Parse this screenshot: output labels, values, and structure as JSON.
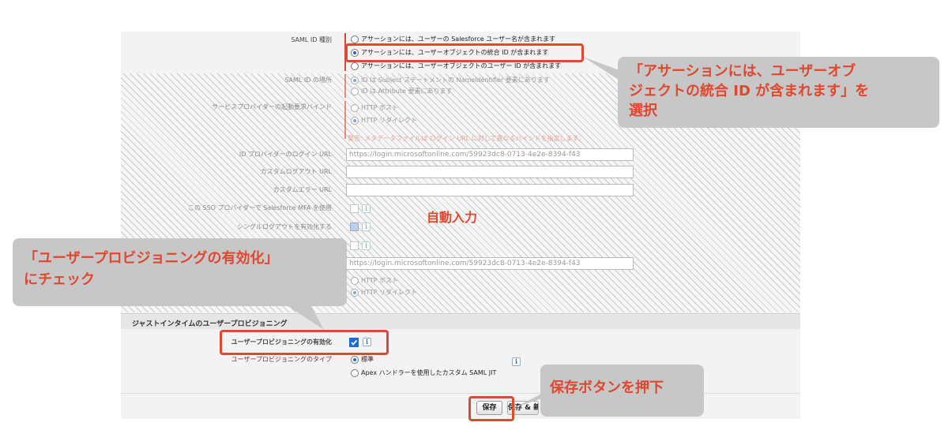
{
  "saml_id_type": {
    "label": "SAML ID 種別",
    "options": [
      "アサーションには、ユーザーの Salesforce ユーザー名が含まれます",
      "アサーションには、ユーザーオブジェクトの統合 ID が含まれます",
      "アサーションには、ユーザーオブジェクトのユーザー ID が含まれます"
    ],
    "selected_index": 1
  },
  "saml_id_location": {
    "label": "SAML ID の場所",
    "options": [
      "ID は Subject ステートメントの NameIdentifier 要素にあります",
      "ID は Attribute 要素にあります"
    ]
  },
  "sp_binding": {
    "label": "サービスプロバイダーの起動要求バインド",
    "options": [
      "HTTP ポスト",
      "HTTP リダイレクト"
    ],
    "warning": "警告: メタデータファイルは ログイン URL に対して異なるバインドを指定します。"
  },
  "idp_login_url": {
    "label": "ID プロバイダーのログイン URL",
    "value": "https://login.microsoftonline.com/59923dc8-0713-4e2e-8394-f43"
  },
  "custom_logout_url": {
    "label": "カスタムログアウト URL",
    "value": ""
  },
  "custom_error_url": {
    "label": "カスタムエラー URL",
    "value": ""
  },
  "sso_mfa": {
    "label": "この SSO プロバイダーで Salesforce MFA を使用"
  },
  "single_logout": {
    "label": "シングルログアウトを有効化する"
  },
  "single_logout_url": {
    "value": "https://login.microsoftonline.com/59923dc8-0713-4e2e-8394-f43"
  },
  "single_logout_binding": {
    "options": [
      "HTTP ポスト",
      "HTTP リダイレクト"
    ]
  },
  "jit_section": {
    "title": "ジャストインタイムのユーザープロビジョニング",
    "enable_label": "ユーザープロビジョニングの有効化",
    "type_label": "ユーザープロビジョニングのタイプ",
    "type_options": [
      "標準",
      "Apex ハンドラーを使用したカスタム SAML JIT"
    ]
  },
  "buttons": {
    "save": "保存",
    "save_new": "保存 & 新規"
  },
  "info_icon_text": "i",
  "annotations": {
    "callout_right": "「アサーションには、ユーザーオブ\nジェクトの統合 ID が含まれます」を\n選択",
    "auto_fill": "自動入力",
    "callout_left": "「ユーザープロビジョニングの有効化」\nにチェック",
    "callout_save": "保存ボタンを押下"
  },
  "colors": {
    "accent_red": "#dc4a33",
    "callout_gray": "#c7c7c7",
    "radio_blue": "#1a6dd1"
  }
}
